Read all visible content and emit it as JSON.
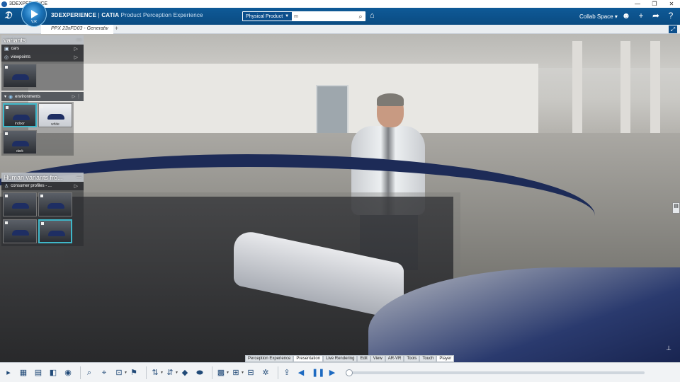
{
  "os": {
    "title": "3DEXPERIENCE",
    "minimize": "—",
    "restore": "❐",
    "close": "✕"
  },
  "header": {
    "logo": "3DS",
    "brand_bold": "3DEXPERIENCE",
    "brand_sep": " | ",
    "brand_product": "CATIA",
    "brand_app": " Product Perception Experience",
    "compass_label": "V.R",
    "search_filter": "Physical Product",
    "search_placeholder": "",
    "search_value": "m",
    "collab_space": "Collab Space",
    "colors": {
      "header": "#0c4f8c",
      "accent": "#3fb7c9"
    }
  },
  "tabs": [
    {
      "label": "PPX 23xFD03 - Generativ"
    }
  ],
  "panels": {
    "variants": {
      "title": "variants",
      "rows": [
        {
          "label": "cars"
        },
        {
          "label": "viewpoints"
        }
      ],
      "environments_label": "environments",
      "env_thumbs": [
        {
          "label": "indoor",
          "selected": true
        },
        {
          "label": "white",
          "selected": false
        },
        {
          "label": "dark",
          "selected": false
        }
      ]
    },
    "human": {
      "title": "Human variants fro...",
      "row_label": "consumer profiles - ...",
      "thumbs": [
        {
          "label": "",
          "selected": false
        },
        {
          "label": "",
          "selected": false
        },
        {
          "label": "",
          "selected": false
        },
        {
          "label": "",
          "selected": true
        }
      ]
    }
  },
  "command_tabs": [
    {
      "label": "Perception Experience",
      "active": false
    },
    {
      "label": "Presentation",
      "active": true
    },
    {
      "label": "Live Rendering",
      "active": false
    },
    {
      "label": "Edit",
      "active": false
    },
    {
      "label": "View",
      "active": false
    },
    {
      "label": "AR-VR",
      "active": false
    },
    {
      "label": "Tools",
      "active": false
    },
    {
      "label": "Touch",
      "active": false
    },
    {
      "label": "Player",
      "active": true
    }
  ],
  "player": {
    "progress": 0
  }
}
